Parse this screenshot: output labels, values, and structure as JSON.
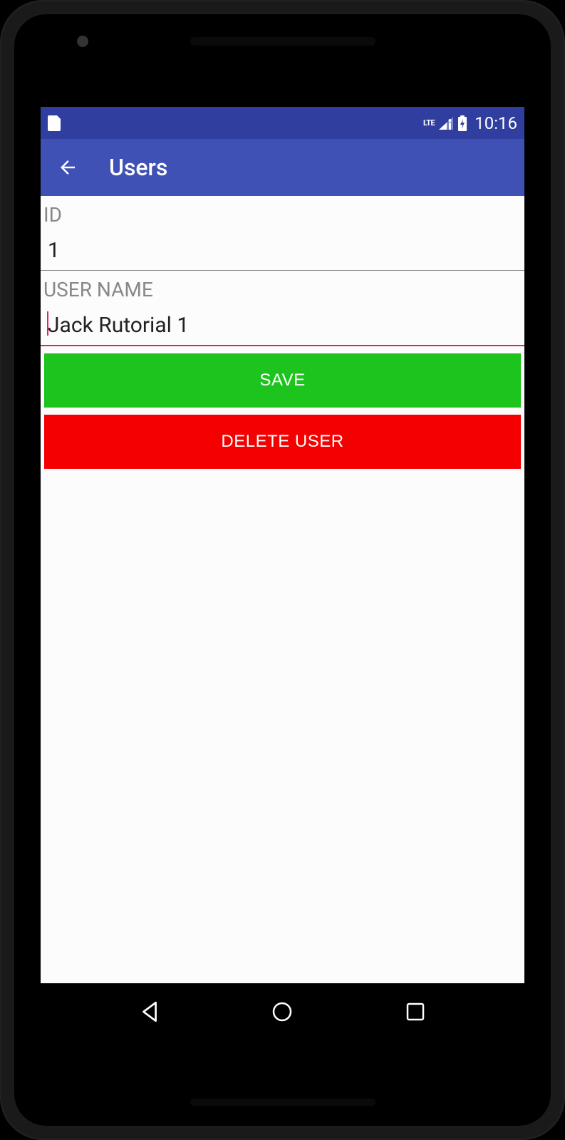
{
  "status_bar": {
    "network_label": "LTE",
    "time": "10:16"
  },
  "app_bar": {
    "title": "Users"
  },
  "form": {
    "id_label": "ID",
    "id_value": "1",
    "username_label": "USER NAME",
    "username_value": "Jack Rutorial 1"
  },
  "buttons": {
    "save": "SAVE",
    "delete": "DELETE USER"
  },
  "colors": {
    "status_bar": "#303f9f",
    "app_bar": "#3f51b5",
    "accent": "#e91e63",
    "save": "#1ec41e",
    "delete": "#f40000"
  }
}
